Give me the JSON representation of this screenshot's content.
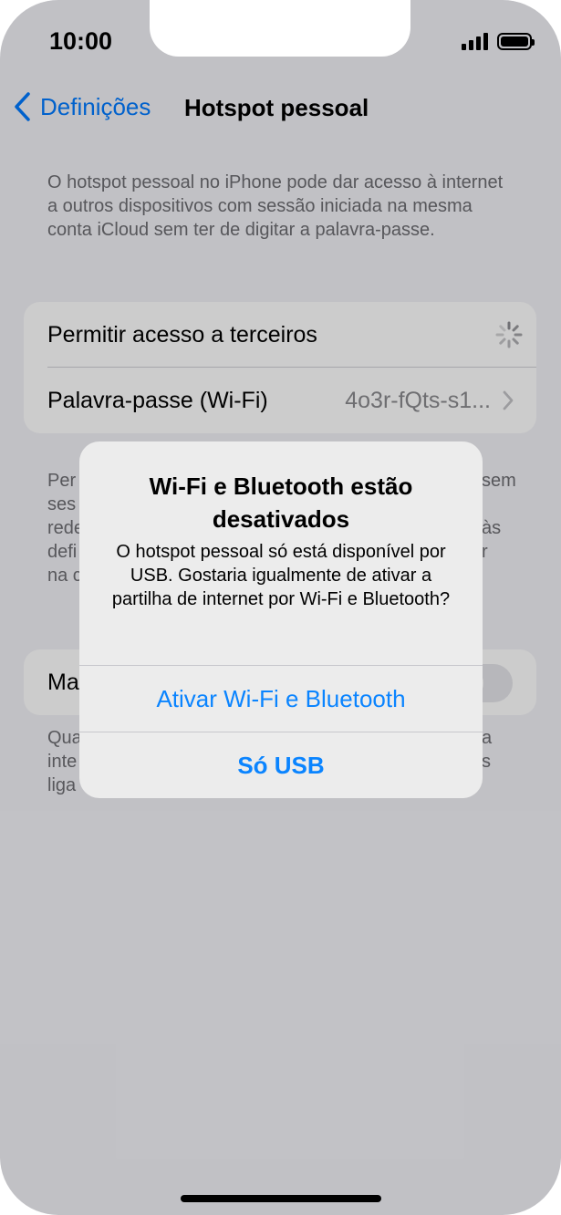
{
  "status": {
    "time": "10:00"
  },
  "nav": {
    "back_label": "Definições",
    "title": "Hotspot pessoal"
  },
  "intro": "O hotspot pessoal no iPhone pode dar acesso à internet a outros dispositivos com sessão iniciada na mesma conta iCloud sem ter de digitar a palavra-passe.",
  "settings": {
    "allow_others": "Permitir acesso a terceiros",
    "password_label": "Palavra-passe (Wi-Fi)",
    "password_value": "4o3r-fQts-s1..."
  },
  "fragments": {
    "left_lines": [
      "Per",
      "ses",
      "rede",
      "defi",
      "na c"
    ],
    "right_lines": [
      "sem",
      "às",
      "r"
    ],
    "max_row": "Ma",
    "bottom_left": [
      "Qua",
      "inte",
      "liga"
    ],
    "bottom_right": [
      "a",
      "s"
    ]
  },
  "alert": {
    "title": "Wi-Fi e Bluetooth estão desativados",
    "message": "O hotspot pessoal só está disponível por USB. Gostaria igualmente de ativar a partilha de internet por Wi-Fi e Bluetooth?",
    "btn_enable": "Ativar Wi-Fi e Bluetooth",
    "btn_usb": "Só USB"
  },
  "colors": {
    "accent": "#0a84ff",
    "background": "#f2f2f7",
    "alert_bg": "#ececec"
  }
}
